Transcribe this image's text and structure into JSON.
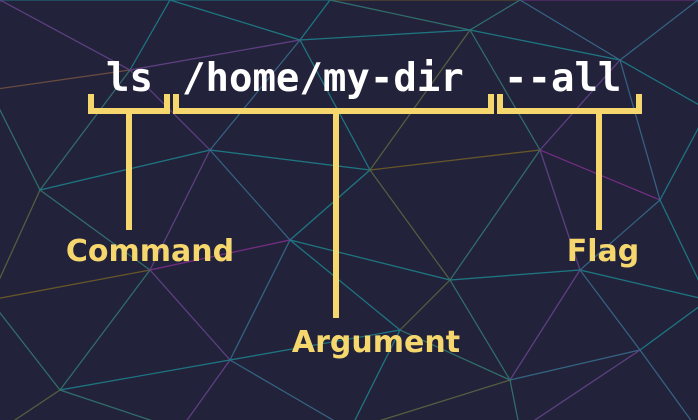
{
  "command_line": {
    "command": "ls",
    "argument": "/home/my-dir",
    "flag": "--all"
  },
  "labels": {
    "command": "Command",
    "argument": "Argument",
    "flag": "Flag"
  },
  "colors": {
    "background": "#22223a",
    "text": "#ffffff",
    "accent": "#f5d76e",
    "mesh_teal": "#1f7a86",
    "mesh_purple": "#7a2f86",
    "mesh_brown": "#6b5a2a"
  }
}
